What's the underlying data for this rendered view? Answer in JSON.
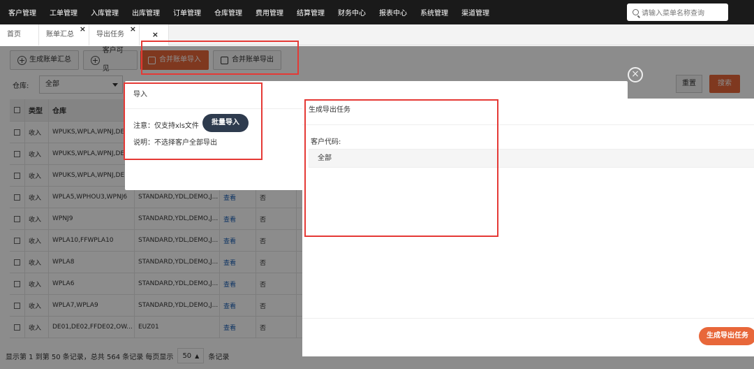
{
  "topnav": {
    "menu": [
      "客户管理",
      "工单管理",
      "入库管理",
      "出库管理",
      "订单管理",
      "仓库管理",
      "费用管理",
      "结算管理",
      "财务中心",
      "报表中心",
      "系统管理",
      "渠道管理"
    ],
    "search_placeholder": "请输入菜单名称查询"
  },
  "tabs": [
    {
      "label": "首页"
    },
    {
      "label": "账单汇总"
    },
    {
      "label": "导出任务"
    }
  ],
  "toolbar": {
    "generate_bill": "生成账单汇总",
    "customer_visible": "客户可见",
    "merge_import": "合并账单导入",
    "merge_export": "合并账单导出"
  },
  "filters": {
    "warehouse_label": "仓库:",
    "warehouse_value": "全部",
    "reset": "重置",
    "search": "搜索"
  },
  "table": {
    "headers": [
      "类型",
      "仓库"
    ],
    "rows": [
      {
        "type": "收入",
        "warehouse": "WPUKS,WPLA,WPNJ,DE",
        "c3": "",
        "c4": "",
        "c5": ""
      },
      {
        "type": "收入",
        "warehouse": "WPUKS,WPLA,WPNJ,DE",
        "c3": "",
        "c4": "",
        "c5": ""
      },
      {
        "type": "收入",
        "warehouse": "WPUKS,WPLA,WPNJ,DE",
        "c3": "",
        "c4": "",
        "c5": ""
      },
      {
        "type": "收入",
        "warehouse": "WPLA5,WPHOU3,WPNJ6",
        "c3": "STANDARD,YDL,DEMO,J...",
        "c4": "查看",
        "c5": "否"
      },
      {
        "type": "收入",
        "warehouse": "WPNJ9",
        "c3": "STANDARD,YDL,DEMO,J...",
        "c4": "查看",
        "c5": "否"
      },
      {
        "type": "收入",
        "warehouse": "WPLA10,FFWPLA10",
        "c3": "STANDARD,YDL,DEMO,J...",
        "c4": "查看",
        "c5": "否"
      },
      {
        "type": "收入",
        "warehouse": "WPLA8",
        "c3": "STANDARD,YDL,DEMO,J...",
        "c4": "查看",
        "c5": "否"
      },
      {
        "type": "收入",
        "warehouse": "WPLA6",
        "c3": "STANDARD,YDL,DEMO,J...",
        "c4": "查看",
        "c5": "否"
      },
      {
        "type": "收入",
        "warehouse": "WPLA7,WPLA9",
        "c3": "STANDARD,YDL,DEMO,J...",
        "c4": "查看",
        "c5": "否"
      },
      {
        "type": "收入",
        "warehouse": "DE01,DE02,FFDE02,OW...",
        "c3": "EUZ01",
        "c4": "查看",
        "c5": "否"
      }
    ]
  },
  "footer": {
    "summary": "显示第 1 到第 50 条记录，总共 564 条记录 每页显示",
    "page_size": "50",
    "suffix": "条记录"
  },
  "import_dialog": {
    "title": "导入",
    "note": "注意：仅支持xls文件",
    "batch_import": "批量导入",
    "description": "说明：不选择客户全部导出"
  },
  "export_dialog": {
    "title": "生成导出任务",
    "customer_code_label": "客户代码:",
    "customer_code_value": "全部",
    "generate_button": "生成导出任务"
  }
}
